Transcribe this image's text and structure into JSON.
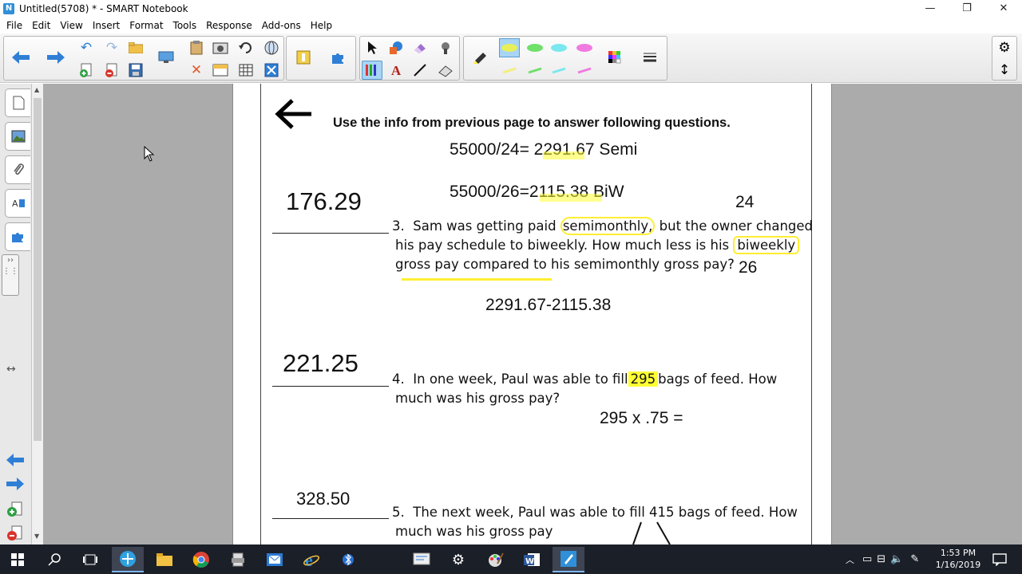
{
  "window": {
    "title": "Untitled(5708) * - SMART Notebook",
    "minimize": "—",
    "restore": "❐",
    "close": "✕"
  },
  "menu": [
    "File",
    "Edit",
    "View",
    "Insert",
    "Format",
    "Tools",
    "Response",
    "Add-ons",
    "Help"
  ],
  "colors": {
    "highlight_yellow": "#ffff33",
    "accent_blue": "#2f7fd6",
    "panel_grey": "#ababab",
    "taskbar": "#1b1f28"
  },
  "page": {
    "heading": "Use the info from previous page to answer following questions.",
    "work_semi": "55000/24= 2291.67 Semi",
    "work_biw": "55000/26=2115.38  BiW",
    "note_24": "24",
    "note_26": "26",
    "q3": {
      "answer": "176.29",
      "number": "3.",
      "line1_a": "Sam was getting paid",
      "line1_hl": "semimonthly,",
      "line1_b": "but the owner changed",
      "line2_a": "his pay schedule to biweekly.  How much less is his",
      "line2_hl": "biweekly",
      "line3": "gross pay compared to his semimonthly gross pay?",
      "work": "2291.67-2115.38"
    },
    "q4": {
      "answer": "221.25",
      "number": "4.",
      "line1_a": "In one week, Paul was able to fill",
      "line1_hl": "295",
      "line1_b": "bags of feed.  How",
      "line2": "much was his gross pay?",
      "work": "295 x .75 ="
    },
    "q5": {
      "answer": "328.50",
      "number": "5.",
      "line1": "The next week, Paul was able to fill 415 bags of feed.  How",
      "line2": "much was his gross pay"
    }
  },
  "taskbar": {
    "time": "1:53 PM",
    "date": "1/16/2019"
  }
}
